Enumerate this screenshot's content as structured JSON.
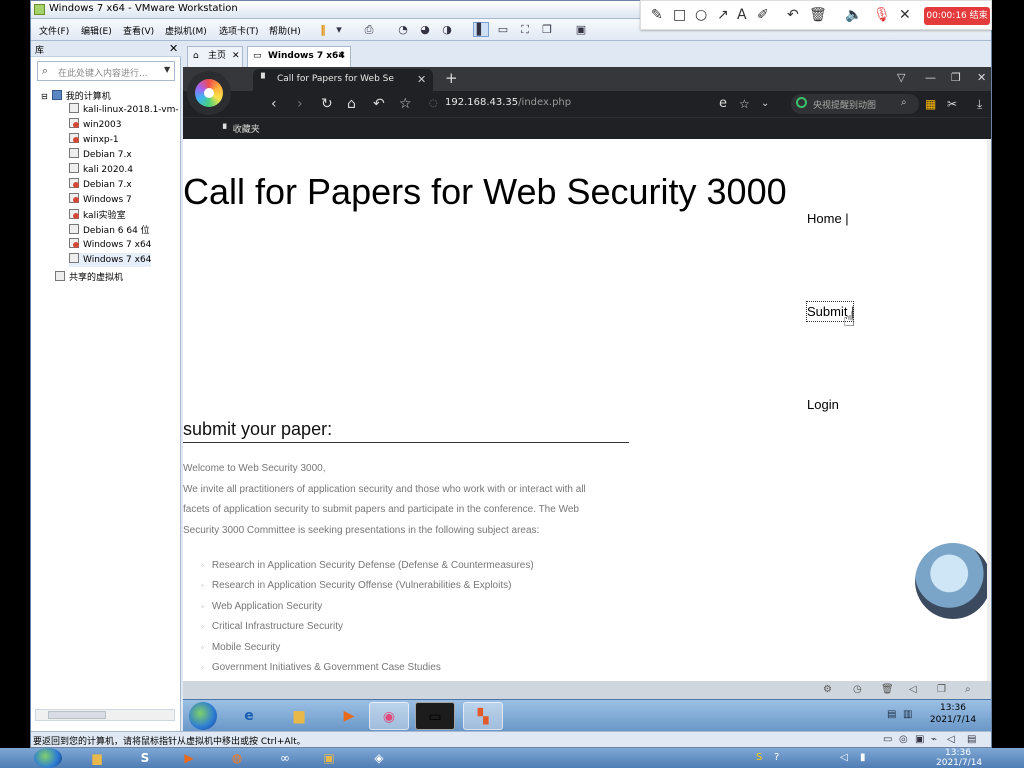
{
  "vmware": {
    "title": "Windows 7 x64 - VMware Workstation",
    "menu": [
      "文件(F)",
      "编辑(E)",
      "查看(V)",
      "虚拟机(M)",
      "选项卡(T)",
      "帮助(H)"
    ],
    "status_text": "要返回到您的计算机，请将鼠标指针从虚拟机中移出或按 Ctrl+Alt。"
  },
  "recorder": {
    "timer": "00:00:16 结束"
  },
  "library": {
    "title": "库",
    "search_placeholder": "在此处键入内容进行...",
    "root": "我的计算机",
    "items": [
      {
        "label": "kali-linux-2018.1-vm-",
        "red": false
      },
      {
        "label": "win2003",
        "red": true
      },
      {
        "label": "winxp-1",
        "red": true
      },
      {
        "label": "Debian 7.x",
        "red": false
      },
      {
        "label": "kali 2020.4",
        "red": false
      },
      {
        "label": "Debian 7.x",
        "red": true
      },
      {
        "label": "Windows 7",
        "red": true
      },
      {
        "label": "kali实验室",
        "red": true
      },
      {
        "label": "Debian 6 64 位",
        "red": false
      },
      {
        "label": "Windows 7 x64",
        "red": true
      },
      {
        "label": "Windows 7 x64",
        "red": false
      }
    ],
    "shared": "共享的虚拟机"
  },
  "vm_tabs": {
    "home": "主页",
    "active": "Windows 7 x64"
  },
  "browser": {
    "tab_title": "Call for Papers for Web Se",
    "url_host": "192.168.43.35",
    "url_path": "/index.php",
    "search_text": "央视提醒别动图",
    "bookmark": "收藏夹"
  },
  "page": {
    "title": "Call for Papers for Web Security 3000",
    "nav": {
      "home": "Home |",
      "submit": "Submit |",
      "login": "Login"
    },
    "subtitle": "submit your paper:",
    "paragraphs": [
      "Welcome to Web Security 3000,",
      "We invite all practitioners of application security and those who work with or interact with all",
      "facets of application security to submit papers and participate in the conference. The Web",
      "Security 3000 Committee is seeking presentations in the following subject areas:"
    ],
    "topics": [
      "Research in Application Security Defense (Defense & Countermeasures)",
      "Research in Application Security Offense (Vulnerabilities & Exploits)",
      "Web Application Security",
      "Critical Infrastructure Security",
      "Mobile Security",
      "Government Initiatives & Government Case Studies"
    ]
  },
  "guest_clock": {
    "time": "13:36",
    "date": "2021/7/14"
  },
  "host_clock": {
    "time": "13:36",
    "date": "2021/7/14"
  }
}
